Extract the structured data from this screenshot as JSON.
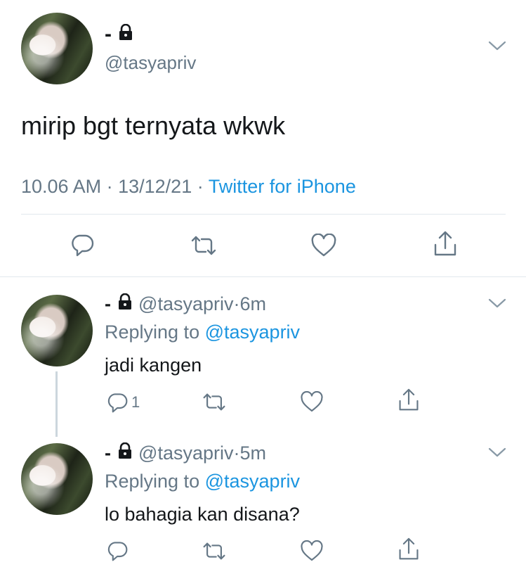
{
  "main_tweet": {
    "display_name": "-",
    "handle": "@tasyapriv",
    "text": "mirip bgt ternyata wkwk",
    "time": "10.06 AM",
    "date": "13/12/21",
    "source": "Twitter for iPhone",
    "separator": "·"
  },
  "replies": [
    {
      "display_name": "-",
      "handle": "@tasyapriv",
      "time_ago": "6m",
      "replying_label": "Replying to",
      "replying_handle": "@tasyapriv",
      "text": "jadi kangen",
      "reply_count": "1"
    },
    {
      "display_name": "-",
      "handle": "@tasyapriv",
      "time_ago": "5m",
      "replying_label": "Replying to",
      "replying_handle": "@tasyapriv",
      "text": "lo bahagia kan disana?",
      "reply_count": ""
    }
  ],
  "separator": "·",
  "icons": [
    "lock-icon",
    "chevron-down-icon",
    "reply-icon",
    "retweet-icon",
    "like-icon",
    "share-icon"
  ],
  "colors": {
    "link": "#1b95e0",
    "secondary": "#657786",
    "divider": "#e1e8ed",
    "text": "#14171a"
  }
}
